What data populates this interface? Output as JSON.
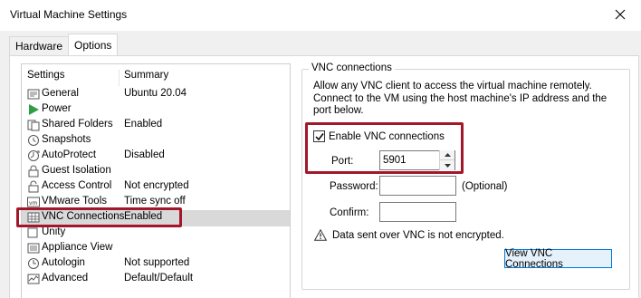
{
  "window": {
    "title": "Virtual Machine Settings"
  },
  "tabs": [
    {
      "label": "Hardware",
      "active": false
    },
    {
      "label": "Options",
      "active": true
    }
  ],
  "settings_list": {
    "headers": {
      "settings": "Settings",
      "summary": "Summary"
    },
    "items": [
      {
        "label": "General",
        "summary": "Ubuntu 20.04",
        "icon": "general-icon"
      },
      {
        "label": "Power",
        "summary": "",
        "icon": "power-icon"
      },
      {
        "label": "Shared Folders",
        "summary": "Enabled",
        "icon": "shared-folders-icon"
      },
      {
        "label": "Snapshots",
        "summary": "",
        "icon": "snapshots-icon"
      },
      {
        "label": "AutoProtect",
        "summary": "Disabled",
        "icon": "autoprotect-icon"
      },
      {
        "label": "Guest Isolation",
        "summary": "",
        "icon": "guest-isolation-icon"
      },
      {
        "label": "Access Control",
        "summary": "Not encrypted",
        "icon": "access-control-icon"
      },
      {
        "label": "VMware Tools",
        "summary": "Time sync off",
        "icon": "vmware-tools-icon"
      },
      {
        "label": "VNC Connections",
        "summary": "Enabled",
        "icon": "vnc-connections-icon",
        "selected": true
      },
      {
        "label": "Unity",
        "summary": "",
        "icon": "unity-icon"
      },
      {
        "label": "Appliance View",
        "summary": "",
        "icon": "appliance-view-icon"
      },
      {
        "label": "Autologin",
        "summary": "Not supported",
        "icon": "autologin-icon"
      },
      {
        "label": "Advanced",
        "summary": "Default/Default",
        "icon": "advanced-icon"
      }
    ]
  },
  "vnc": {
    "group_title": "VNC connections",
    "description": "Allow any VNC client to access the virtual machine remotely. Connect to the VM using the host machine's IP address and the port below.",
    "enable_label": "Enable VNC connections",
    "enabled": true,
    "port_label": "Port:",
    "port_value": "5901",
    "password_label": "Password:",
    "password_value": "",
    "optional_label": "(Optional)",
    "confirm_label": "Confirm:",
    "confirm_value": "",
    "warning_text": "Data sent over VNC is not encrypted.",
    "view_button": "View VNC Connections"
  },
  "colors": {
    "highlight": "#a3172a",
    "accent": "#0078d7",
    "power_green": "#2ea043"
  }
}
